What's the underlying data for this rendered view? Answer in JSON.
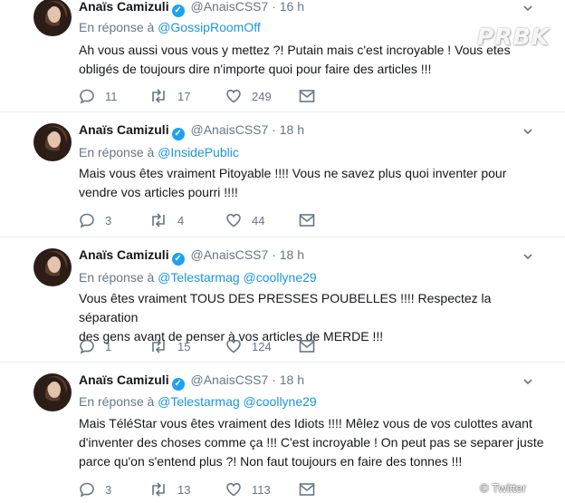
{
  "tweets": [
    {
      "name": "Anaïs Camizuli",
      "handle": "@AnaisCSS7",
      "dot": "·",
      "time": "16 h",
      "reply_prefix": "En réponse à",
      "mentions": "@GossipRoomOff",
      "text_lines": [
        "Ah vous aussi vous vous y mettez ?! Putain mais c'est incroyable ! Vous etes",
        "obligés de toujours dire n'importe quoi pour faire des articles !!!"
      ],
      "replies": "11",
      "retweets": "17",
      "likes": "249"
    },
    {
      "name": "Anaïs Camizuli",
      "handle": "@AnaisCSS7",
      "dot": "·",
      "time": "18 h",
      "reply_prefix": "En réponse à",
      "mentions": "@InsidePublic",
      "text_lines": [
        "Mais vous êtes vraiment Pitoyable !!!! Vous ne savez plus quoi inventer pour",
        "vendre vos articles pourri !!!!"
      ],
      "replies": "3",
      "retweets": "4",
      "likes": "44"
    },
    {
      "name": "Anaïs Camizuli",
      "handle": "@AnaisCSS7",
      "dot": "·",
      "time": "18 h",
      "reply_prefix": "En réponse à",
      "mentions": "@Telestarmag @coollyne29",
      "text_lines": [
        "Vous êtes vraiment TOUS DES PRESSES POUBELLES !!!! Respectez la séparation",
        "des gens avant de penser à vos articles de MERDE !!!"
      ],
      "replies": "1",
      "retweets": "15",
      "likes": "124"
    },
    {
      "name": "Anaïs Camizuli",
      "handle": "@AnaisCSS7",
      "dot": "·",
      "time": "18 h",
      "reply_prefix": "En réponse à",
      "mentions": "@Telestarmag @coollyne29",
      "text_lines": [
        "Mais TéléStar vous êtes vraiment des Idiots !!!! Mêlez vous de vos culottes avant",
        "d'inventer des choses comme ça !!! C'est incroyable ! On peut pas se separer juste",
        "parce qu'on s'entend plus ?! Non faut toujours en faire des tonnes !!!"
      ],
      "replies": "3",
      "retweets": "13",
      "likes": "113"
    }
  ],
  "icons": {
    "reply": "reply-icon",
    "retweet": "retweet-icon",
    "like": "heart-icon",
    "dm": "envelope-icon",
    "verified": "verified-badge-icon",
    "more": "chevron-down-icon"
  },
  "verified_mark": "✓",
  "watermark": "PRBK",
  "credit": "© Twitter",
  "colors": {
    "mention": "#1b95e0",
    "meta": "#657786",
    "verified": "#1da1f2",
    "text": "#14171a"
  }
}
